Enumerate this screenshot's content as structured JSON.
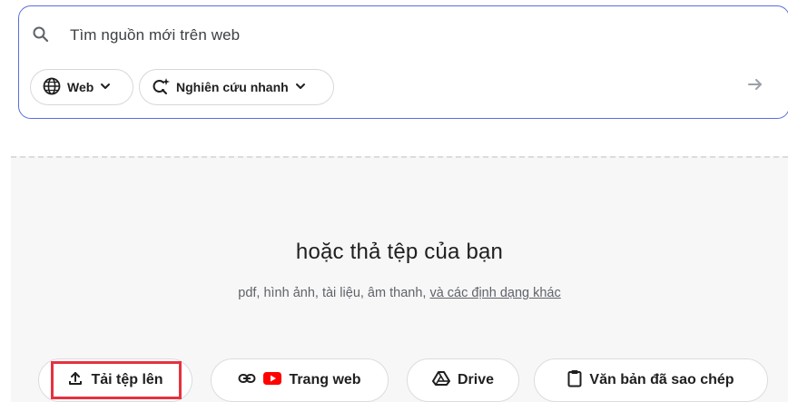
{
  "search": {
    "placeholder": "Tìm nguồn mới trên web",
    "chips": {
      "web_label": "Web",
      "research_label": "Nghiên cứu nhanh"
    }
  },
  "drop_zone": {
    "title": "hoặc thả tệp của bạn",
    "subtitle_prefix": "pdf, hình ảnh, tài liệu, âm thanh, ",
    "subtitle_link": "và các định dạng khác"
  },
  "sources": {
    "upload_label": "Tải tệp lên",
    "website_label": "Trang web",
    "drive_label": "Drive",
    "paste_label": "Văn bản đã sao chép"
  },
  "colors": {
    "accent_border": "#5b6ee0",
    "highlight": "#e5323f",
    "youtube_red": "#ff0000"
  },
  "icons": [
    "search-icon",
    "globe-icon",
    "chevron-down-icon",
    "sparkle-search-icon",
    "arrow-right-icon",
    "upload-icon",
    "link-icon",
    "youtube-icon",
    "drive-icon",
    "clipboard-icon"
  ]
}
